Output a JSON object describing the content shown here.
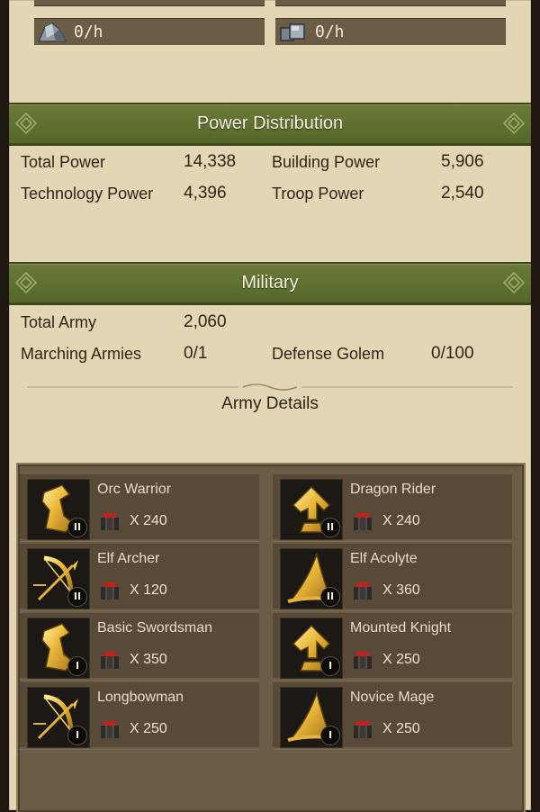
{
  "resources": [
    {
      "icon": "stone-ore-icon",
      "value": "0/h"
    },
    {
      "icon": "iron-ore-icon",
      "value": "0/h"
    }
  ],
  "power": {
    "title": "Power Distribution",
    "total_label": "Total Power",
    "total_value": "14,338",
    "building_label": "Building Power",
    "building_value": "5,906",
    "technology_label": "Technology Power",
    "technology_value": "4,396",
    "troop_label": "Troop Power",
    "troop_value": "2,540"
  },
  "military": {
    "title": "Military",
    "total_army_label": "Total Army",
    "total_army_value": "2,060",
    "marching_label": "Marching Armies",
    "marching_value": "0/1",
    "golem_label": "Defense Golem",
    "golem_value": "0/100",
    "army_details_title": "Army Details"
  },
  "units": [
    {
      "name": "Orc Warrior",
      "count": "X 240",
      "tier": "II",
      "icon": "infantry-icon"
    },
    {
      "name": "Dragon Rider",
      "count": "X 240",
      "tier": "II",
      "icon": "cavalry-icon"
    },
    {
      "name": "Elf Archer",
      "count": "X 120",
      "tier": "II",
      "icon": "archer-icon"
    },
    {
      "name": "Elf Acolyte",
      "count": "X 360",
      "tier": "II",
      "icon": "mage-icon"
    },
    {
      "name": "Basic Swordsman",
      "count": "X 350",
      "tier": "I",
      "icon": "infantry-icon"
    },
    {
      "name": "Mounted Knight",
      "count": "X 250",
      "tier": "I",
      "icon": "cavalry-icon"
    },
    {
      "name": "Longbowman",
      "count": "X 250",
      "tier": "I",
      "icon": "archer-icon"
    },
    {
      "name": "Novice Mage",
      "count": "X 250",
      "tier": "I",
      "icon": "mage-icon"
    }
  ],
  "colors": {
    "parchment": "#e3d6b4",
    "banner_green": "#5f7030",
    "panel_brown": "#584a37",
    "gold": "#e2b23a"
  }
}
